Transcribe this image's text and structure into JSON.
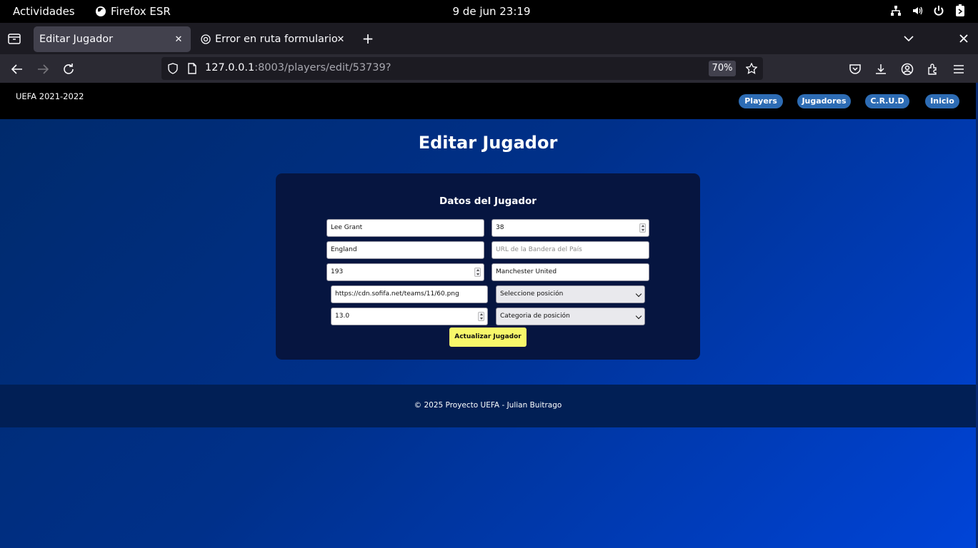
{
  "system": {
    "activities": "Actividades",
    "app_name": "Firefox ESR",
    "clock": "9 de jun  23:19",
    "tray_icons": [
      "network-icon",
      "volume-icon",
      "power-icon",
      "battery-icon"
    ]
  },
  "browser": {
    "tabs": [
      {
        "title": "Editar Jugador",
        "active": true
      },
      {
        "title": "Error en ruta formulario",
        "active": false
      }
    ],
    "url_host": "127.0.0.1",
    "url_rest": ":8003/players/edit/53739?",
    "zoom": "70%"
  },
  "site": {
    "brand": "UEFA 2021-2022",
    "nav": [
      "Players",
      "Jugadores",
      "C.R.U.D",
      "Inicio"
    ],
    "page_title": "Editar Jugador",
    "form": {
      "title": "Datos del Jugador",
      "name_value": "Lee Grant",
      "age_value": "38",
      "country_value": "England",
      "flag_url_placeholder": "URL de la Bandera del País",
      "height_value": "193",
      "club_value": "Manchester United",
      "club_logo_value": "https://cdn.sofifa.net/teams/11/60.png",
      "position_select": "Seleccione posición",
      "value_value": "13.0",
      "position_category_select": "Categoria de posición",
      "submit_label": "Actualizar Jugador"
    },
    "footer": "© 2025 Proyecto UEFA - Julian Buitrago"
  }
}
